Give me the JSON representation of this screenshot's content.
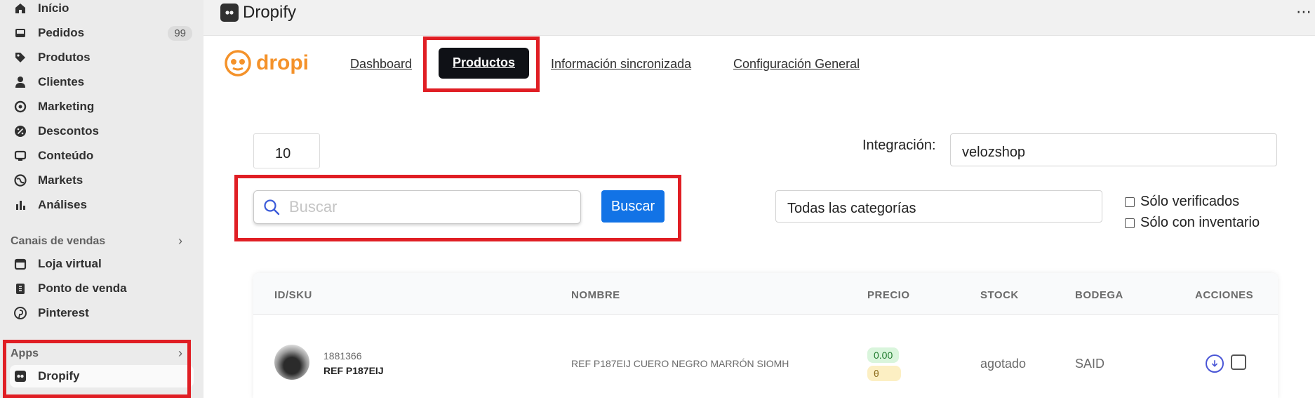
{
  "sidebar": {
    "items": [
      {
        "label": "Início",
        "icon": "home-icon"
      },
      {
        "label": "Pedidos",
        "icon": "inbox-icon",
        "badge": "99"
      },
      {
        "label": "Produtos",
        "icon": "tag-icon"
      },
      {
        "label": "Clientes",
        "icon": "person-icon"
      },
      {
        "label": "Marketing",
        "icon": "target-icon"
      },
      {
        "label": "Descontos",
        "icon": "discount-icon"
      },
      {
        "label": "Conteúdo",
        "icon": "content-icon"
      },
      {
        "label": "Markets",
        "icon": "globe-icon"
      },
      {
        "label": "Análises",
        "icon": "bar-chart-icon"
      }
    ],
    "sales_channels": {
      "title": "Canais de vendas",
      "items": [
        {
          "label": "Loja virtual",
          "icon": "store-icon"
        },
        {
          "label": "Ponto de venda",
          "icon": "pos-icon"
        },
        {
          "label": "Pinterest",
          "icon": "pinterest-icon"
        }
      ]
    },
    "apps": {
      "title": "Apps",
      "items": [
        {
          "label": "Dropify",
          "icon": "dropify-app-icon"
        }
      ]
    }
  },
  "appbar": {
    "title": "Dropify",
    "more": "⋯"
  },
  "dropi": {
    "logo_text": "dropi",
    "tabs": [
      {
        "label": "Dashboard"
      },
      {
        "label": "Productos",
        "active": true
      },
      {
        "label": "Información sincronizada"
      },
      {
        "label": "Configuración General"
      }
    ]
  },
  "controls": {
    "per_page": "10",
    "integration_label": "Integración:",
    "integration_value": "velozshop",
    "search_placeholder": "Buscar",
    "search_button": "Buscar",
    "category_value": "Todas las categorías",
    "checkbox_verified": "Sólo verificados",
    "checkbox_inventory": "Sólo con inventario"
  },
  "table": {
    "headers": [
      "ID/SKU",
      "NOMBRE",
      "PRECIO",
      "STOCK",
      "BODEGA",
      "ACCIONES"
    ],
    "rows": [
      {
        "id": "1881366",
        "sku": "REF P187EIJ",
        "name": "REF P187EIJ CUERO NEGRO MARRÓN SIOMH",
        "price": "0.00",
        "price_secondary": "θ",
        "stock": "agotado",
        "warehouse": "SAID"
      }
    ]
  },
  "colors": {
    "accent_blue": "#1273e6",
    "dropi_orange": "#f4922a",
    "highlight_red": "#e01e24",
    "active_tab": "#0f1116"
  }
}
